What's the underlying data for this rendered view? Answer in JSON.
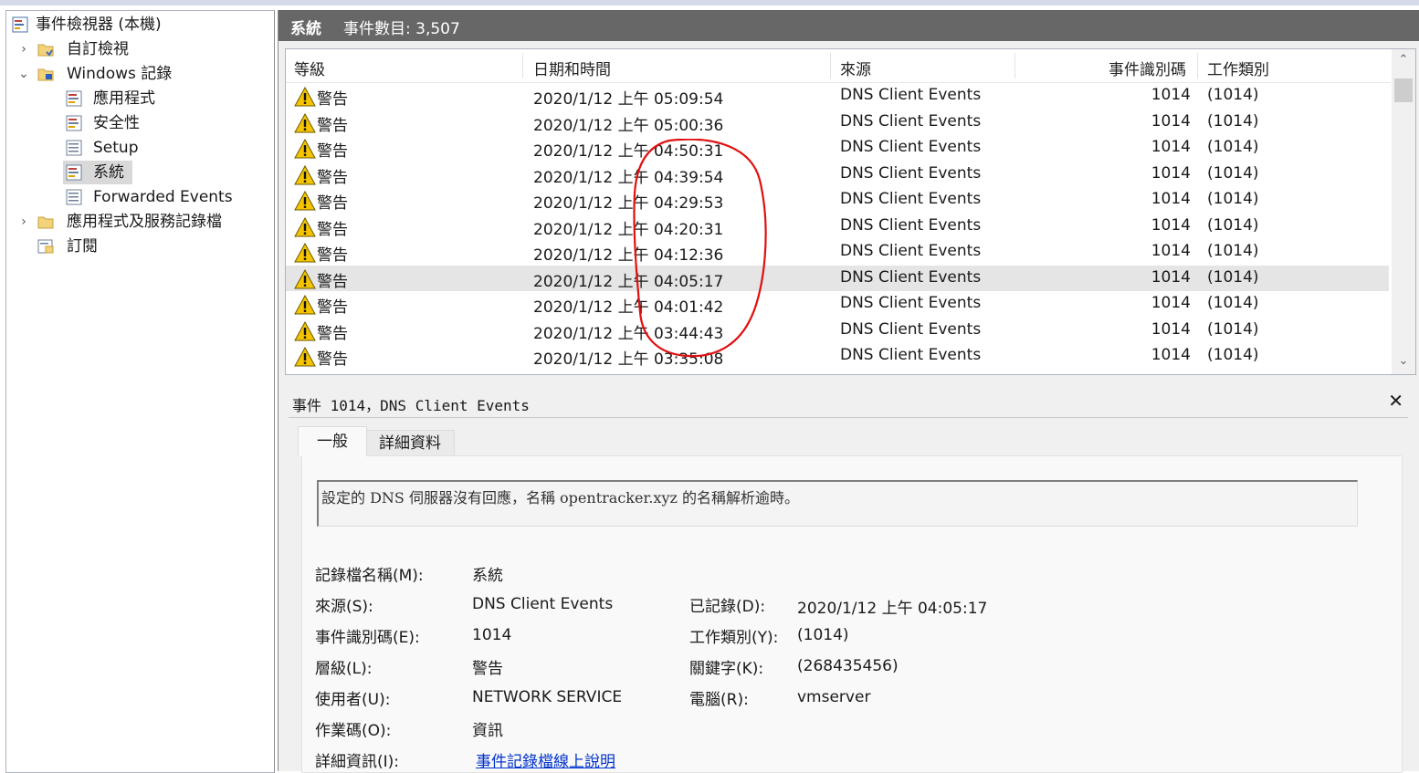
{
  "tree": {
    "root": "事件檢視器 (本機)",
    "custom_views": "自訂檢視",
    "windows_logs": "Windows 記錄",
    "app": "應用程式",
    "security": "安全性",
    "setup": "Setup",
    "system": "系統",
    "forwarded": "Forwarded Events",
    "app_service_logs": "應用程式及服務記錄檔",
    "subscriptions": "訂閱"
  },
  "header": {
    "log_name": "系統",
    "event_count_label": "事件數目: 3,507"
  },
  "columns": {
    "level": "等級",
    "datetime": "日期和時間",
    "source": "來源",
    "event_id": "事件識別碼",
    "task_category": "工作類別"
  },
  "rows": [
    {
      "level": "警告",
      "datetime": "2020/1/12 上午 05:09:54",
      "source": "DNS Client Events",
      "event_id": "1014",
      "task": "(1014)"
    },
    {
      "level": "警告",
      "datetime": "2020/1/12 上午 05:00:36",
      "source": "DNS Client Events",
      "event_id": "1014",
      "task": "(1014)"
    },
    {
      "level": "警告",
      "datetime": "2020/1/12 上午 04:50:31",
      "source": "DNS Client Events",
      "event_id": "1014",
      "task": "(1014)"
    },
    {
      "level": "警告",
      "datetime": "2020/1/12 上午 04:39:54",
      "source": "DNS Client Events",
      "event_id": "1014",
      "task": "(1014)"
    },
    {
      "level": "警告",
      "datetime": "2020/1/12 上午 04:29:53",
      "source": "DNS Client Events",
      "event_id": "1014",
      "task": "(1014)"
    },
    {
      "level": "警告",
      "datetime": "2020/1/12 上午 04:20:31",
      "source": "DNS Client Events",
      "event_id": "1014",
      "task": "(1014)"
    },
    {
      "level": "警告",
      "datetime": "2020/1/12 上午 04:12:36",
      "source": "DNS Client Events",
      "event_id": "1014",
      "task": "(1014)"
    },
    {
      "level": "警告",
      "datetime": "2020/1/12 上午 04:05:17",
      "source": "DNS Client Events",
      "event_id": "1014",
      "task": "(1014)"
    },
    {
      "level": "警告",
      "datetime": "2020/1/12 上午 04:01:42",
      "source": "DNS Client Events",
      "event_id": "1014",
      "task": "(1014)"
    },
    {
      "level": "警告",
      "datetime": "2020/1/12 上午 03:44:43",
      "source": "DNS Client Events",
      "event_id": "1014",
      "task": "(1014)"
    },
    {
      "level": "警告",
      "datetime": "2020/1/12 上午 03:35:08",
      "source": "DNS Client Events",
      "event_id": "1014",
      "task": "(1014)"
    }
  ],
  "selected_row": 7,
  "detail": {
    "title": "事件 1014，DNS Client Events",
    "tab_general": "一般",
    "tab_details": "詳細資料",
    "message": "設定的 DNS 伺服器沒有回應，名稱 opentracker.xyz 的名稱解析逾時。",
    "labels": {
      "log_name": "記錄檔名稱(M):",
      "source": "來源(S):",
      "event_id": "事件識別碼(E):",
      "level": "層級(L):",
      "user": "使用者(U):",
      "opcode": "作業碼(O):",
      "more_info": "詳細資訊(I):",
      "logged": "已記錄(D):",
      "task_category": "工作類別(Y):",
      "keywords": "關鍵字(K):",
      "computer": "電腦(R):"
    },
    "values": {
      "log_name": "系統",
      "source": "DNS Client Events",
      "event_id": "1014",
      "level": "警告",
      "user": "NETWORK SERVICE",
      "opcode": "資訊",
      "more_info_link": "事件記錄檔線上說明",
      "logged": "2020/1/12 上午 04:05:17",
      "task_category": "(1014)",
      "keywords": "(268435456)",
      "computer": "vmserver"
    }
  },
  "colors": {
    "header_bg": "#676767",
    "annotation": "#e01010",
    "link": "#0033cc",
    "warning": "#f5c400"
  },
  "icons": {
    "warning": "warning-icon",
    "close": "close-icon"
  }
}
